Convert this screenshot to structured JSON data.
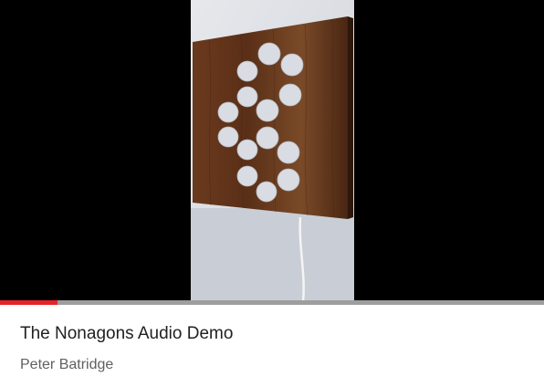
{
  "video": {
    "title": "The Nonagons Audio Demo",
    "channel": "Peter Batridge",
    "progress_fraction": 0.105
  },
  "colors": {
    "progress_played": "#e5242a",
    "progress_track": "#9e9e9e",
    "title": "#212121",
    "channel": "#606060"
  }
}
